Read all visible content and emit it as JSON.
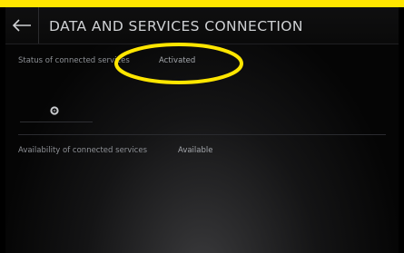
{
  "header": {
    "title": "DATA AND SERVICES CONNECTION",
    "back_icon": "back-arrow-icon"
  },
  "status": {
    "label": "Status of connected services",
    "value": "Activated"
  },
  "availability": {
    "label": "Availability of connected services",
    "value": "Available"
  },
  "icons": {
    "status_ring": "ring-icon"
  },
  "colors": {
    "highlight": "#ffe600",
    "background": "#000000"
  }
}
